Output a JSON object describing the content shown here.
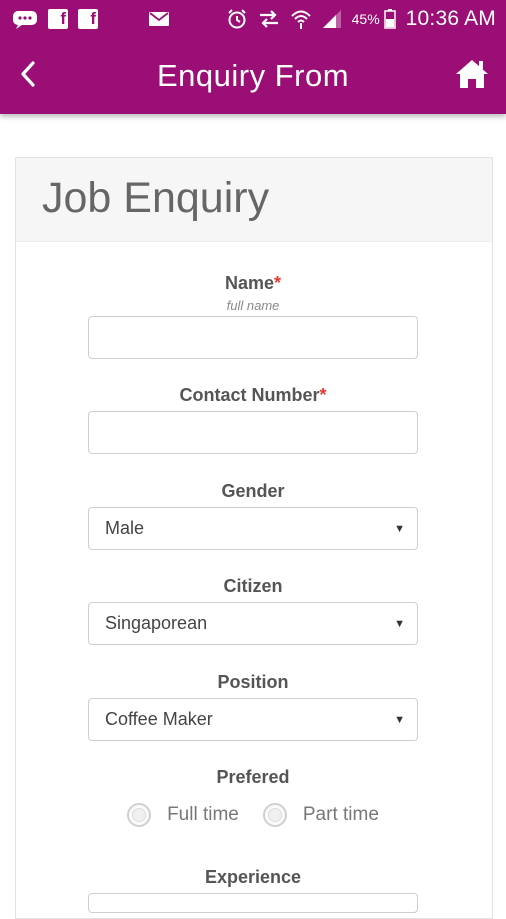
{
  "status_bar": {
    "battery": "45%",
    "time": "10:36 AM",
    "icons": [
      "message-icon",
      "facebook-icon",
      "facebook-icon",
      "mail-icon",
      "alarm-icon",
      "data-transfer-icon",
      "wifi-icon",
      "signal-icon",
      "battery-icon"
    ]
  },
  "app_bar": {
    "title": "Enquiry From",
    "back_icon": "back-chevron-icon",
    "home_icon": "home-icon"
  },
  "form": {
    "title": "Job Enquiry",
    "name": {
      "label": "Name",
      "required": "*",
      "hint": "full name",
      "value": ""
    },
    "contact": {
      "label": "Contact Number",
      "required": "*",
      "value": ""
    },
    "gender": {
      "label": "Gender",
      "value": "Male"
    },
    "citizen": {
      "label": "Citizen",
      "value": "Singaporean"
    },
    "position": {
      "label": "Position",
      "value": "Coffee Maker"
    },
    "prefered": {
      "label": "Prefered",
      "options": [
        "Full time",
        "Part time"
      ]
    },
    "experience": {
      "label": "Experience"
    }
  },
  "colors": {
    "primary": "#9b0e76",
    "required": "#e53935"
  }
}
